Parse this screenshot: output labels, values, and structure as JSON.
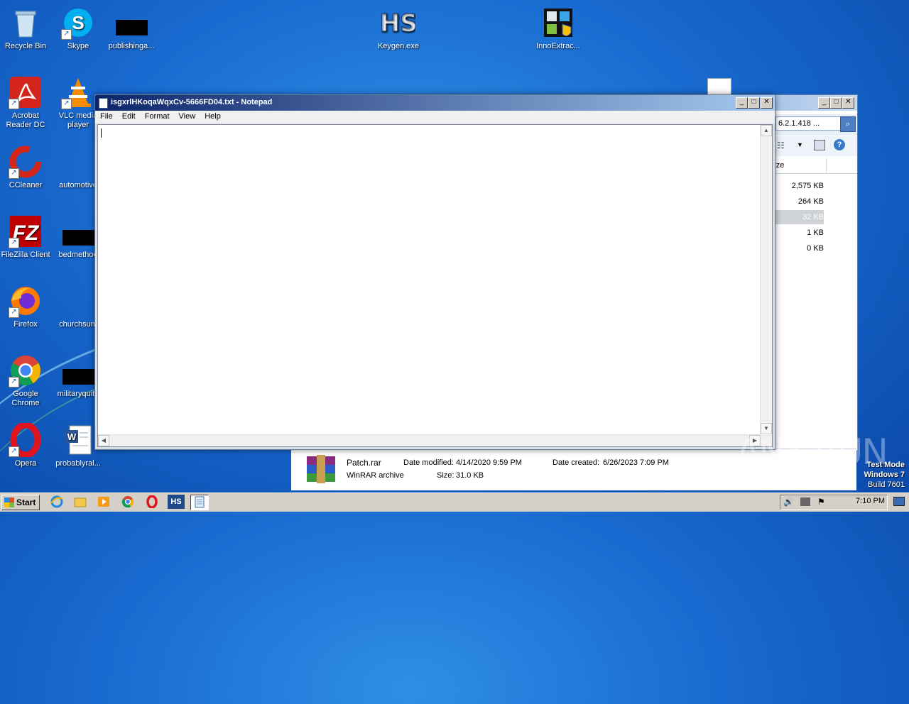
{
  "desktop": {
    "icons": [
      {
        "label": "Recycle Bin"
      },
      {
        "label": "Skype"
      },
      {
        "label": "publishinga..."
      },
      {
        "label": "Keygen.exe"
      },
      {
        "label": "InnoExtrac..."
      },
      {
        "label": "Acrobat Reader DC"
      },
      {
        "label": "VLC media player"
      },
      {
        "label": "CCleaner"
      },
      {
        "label": "automotive"
      },
      {
        "label": "FileZilla Client"
      },
      {
        "label": "bedmethod"
      },
      {
        "label": "Firefox"
      },
      {
        "label": "churchsum"
      },
      {
        "label": "Google Chrome"
      },
      {
        "label": "militaryquite"
      },
      {
        "label": "Opera"
      },
      {
        "label": "probablyral..."
      }
    ]
  },
  "notepad": {
    "title": "isgxrlHKoqaWqxCv-5666FD04.txt - Notepad",
    "menu": [
      "File",
      "Edit",
      "Format",
      "View",
      "Help"
    ],
    "content": ""
  },
  "explorer": {
    "address": "6.2.1.418 ...",
    "column_size": "Size",
    "sizes": [
      "2,575 KB",
      "264 KB",
      "32 KB",
      "1 KB",
      "0 KB"
    ],
    "details": {
      "filename": "Patch.rar",
      "type": "WinRAR archive",
      "date_modified_label": "Date modified:",
      "date_modified": "4/14/2020 9:59 PM",
      "date_created_label": "Date created:",
      "date_created": "6/26/2023 7:09 PM",
      "size_label": "Size:",
      "size": "31.0 KB"
    }
  },
  "watermark": "ANY RUN",
  "testmode": {
    "line1": "Test Mode",
    "line2": "Windows 7",
    "line3": "Build 7601"
  },
  "taskbar": {
    "start_label": "Start",
    "clock": "7:10 PM"
  }
}
